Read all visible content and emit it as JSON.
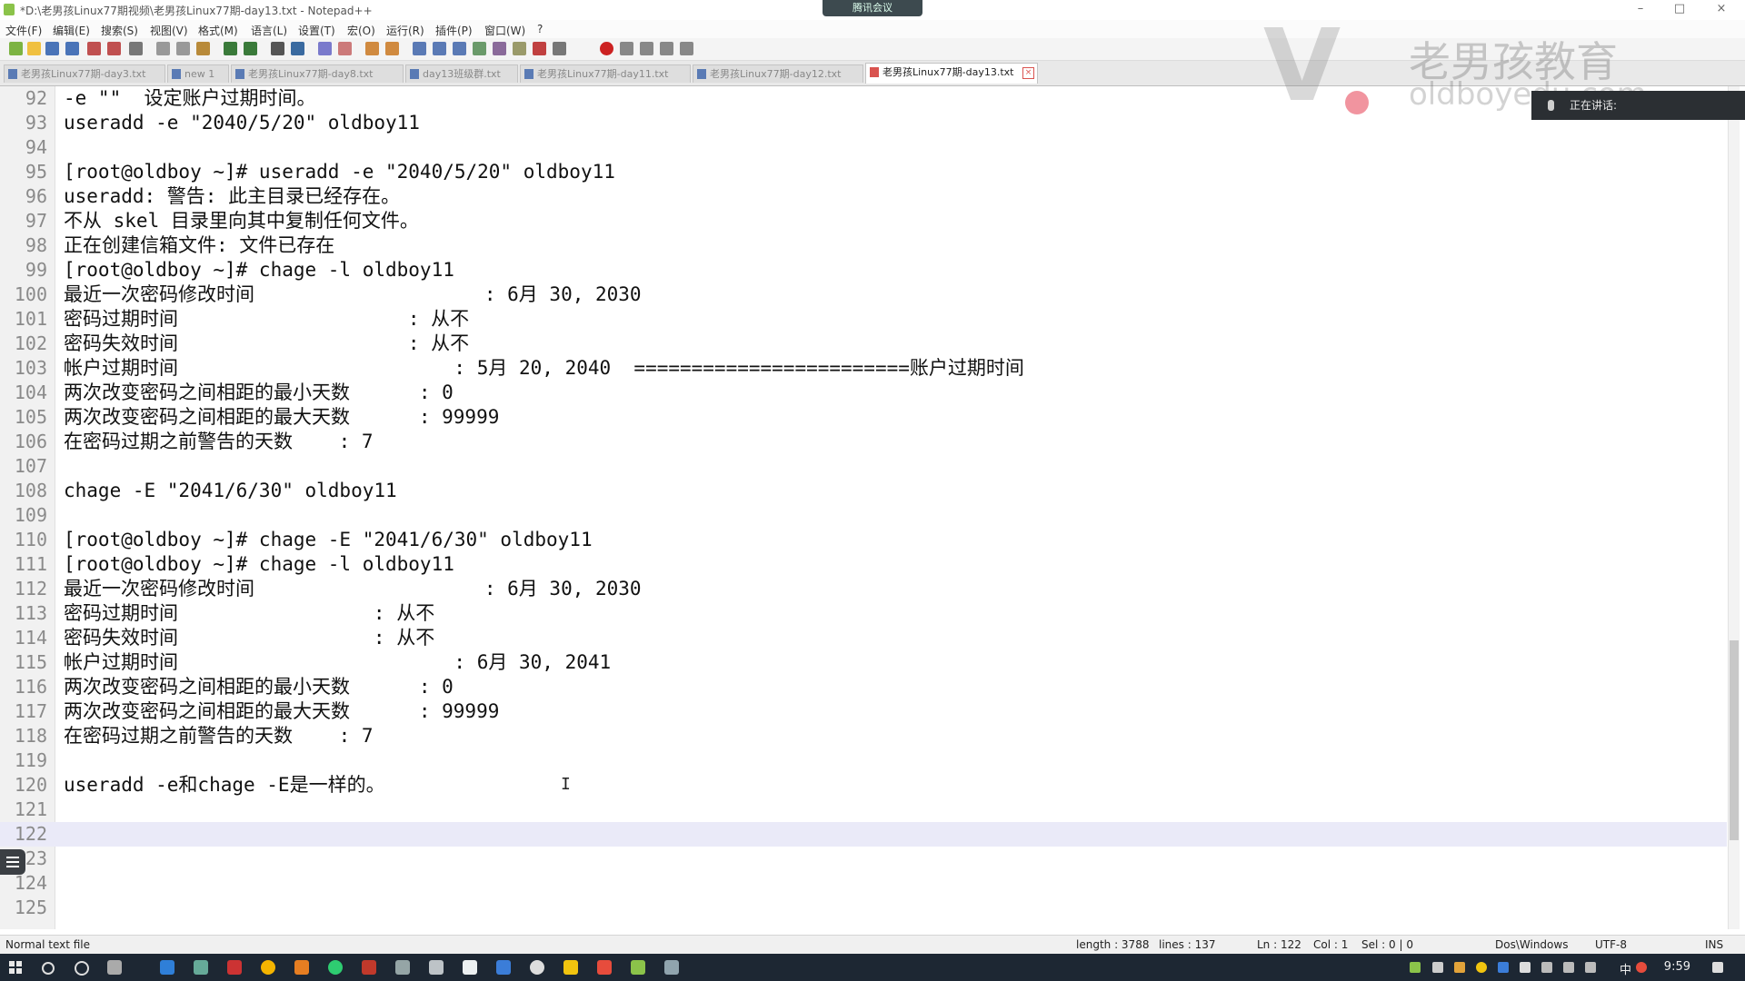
{
  "window": {
    "title": "*D:\\老男孩Linux77期视频\\老男孩Linux77期-day13.txt - Notepad++",
    "meeting_pill": "腾讯会议",
    "minimize": "–",
    "maximize": "□",
    "close": "×"
  },
  "menu": [
    "文件(F)",
    "编辑(E)",
    "搜索(S)",
    "视图(V)",
    "格式(M)",
    "语言(L)",
    "设置(T)",
    "宏(O)",
    "运行(R)",
    "插件(P)",
    "窗口(W)",
    "?"
  ],
  "tabs": [
    {
      "label": "老男孩Linux77期-day3.txt"
    },
    {
      "label": "new 1"
    },
    {
      "label": "老男孩Linux77期-day8.txt"
    },
    {
      "label": "day13班级群.txt"
    },
    {
      "label": "老男孩Linux77期-day11.txt"
    },
    {
      "label": "老男孩Linux77期-day12.txt"
    },
    {
      "label": "老男孩Linux77期-day13.txt",
      "active": true
    }
  ],
  "watermark": {
    "cn": "老男孩教育",
    "en": "oldboyedu.com"
  },
  "speaking_label": "正在讲话:",
  "lines": [
    {
      "n": "92",
      "t": "-e \"\"  设定账户过期时间。"
    },
    {
      "n": "93",
      "t": "useradd -e \"2040/5/20\" oldboy11"
    },
    {
      "n": "94",
      "t": ""
    },
    {
      "n": "95",
      "t": "[root@oldboy ~]# useradd -e \"2040/5/20\" oldboy11"
    },
    {
      "n": "96",
      "t": "useradd: 警告: 此主目录已经存在。"
    },
    {
      "n": "97",
      "t": "不从 skel 目录里向其中复制任何文件。"
    },
    {
      "n": "98",
      "t": "正在创建信箱文件: 文件已存在"
    },
    {
      "n": "99",
      "t": "[root@oldboy ~]# chage -l oldboy11"
    },
    {
      "n": "100",
      "t": "最近一次密码修改时间                    : 6月 30, 2030"
    },
    {
      "n": "101",
      "t": "密码过期时间                    : 从不"
    },
    {
      "n": "102",
      "t": "密码失效时间                    : 从不"
    },
    {
      "n": "103",
      "t": "帐户过期时间                        : 5月 20, 2040  ========================账户过期时间"
    },
    {
      "n": "104",
      "t": "两次改变密码之间相距的最小天数      : 0"
    },
    {
      "n": "105",
      "t": "两次改变密码之间相距的最大天数      : 99999"
    },
    {
      "n": "106",
      "t": "在密码过期之前警告的天数    : 7"
    },
    {
      "n": "107",
      "t": ""
    },
    {
      "n": "108",
      "t": "chage -E \"2041/6/30\" oldboy11"
    },
    {
      "n": "109",
      "t": ""
    },
    {
      "n": "110",
      "t": "[root@oldboy ~]# chage -E \"2041/6/30\" oldboy11"
    },
    {
      "n": "111",
      "t": "[root@oldboy ~]# chage -l oldboy11"
    },
    {
      "n": "112",
      "t": "最近一次密码修改时间                    : 6月 30, 2030"
    },
    {
      "n": "113",
      "t": "密码过期时间                 : 从不"
    },
    {
      "n": "114",
      "t": "密码失效时间                 : 从不"
    },
    {
      "n": "115",
      "t": "帐户过期时间                        : 6月 30, 2041"
    },
    {
      "n": "116",
      "t": "两次改变密码之间相距的最小天数      : 0"
    },
    {
      "n": "117",
      "t": "两次改变密码之间相距的最大天数      : 99999"
    },
    {
      "n": "118",
      "t": "在密码过期之前警告的天数    : 7"
    },
    {
      "n": "119",
      "t": ""
    },
    {
      "n": "120",
      "t": "useradd -e和chage -E是一样的。"
    },
    {
      "n": "121",
      "t": ""
    },
    {
      "n": "122",
      "t": "",
      "current": true
    },
    {
      "n": "123",
      "t": ""
    },
    {
      "n": "124",
      "t": ""
    },
    {
      "n": "125",
      "t": ""
    }
  ],
  "status": {
    "type": "Normal text file",
    "length": "length : 3788",
    "lines": "lines : 137",
    "ln": "Ln : 122",
    "col": "Col : 1",
    "sel": "Sel : 0 | 0",
    "eol": "Dos\\Windows",
    "encoding": "UTF-8",
    "mode": "INS"
  },
  "taskbar": {
    "ime": "中",
    "clock": "9:59"
  }
}
